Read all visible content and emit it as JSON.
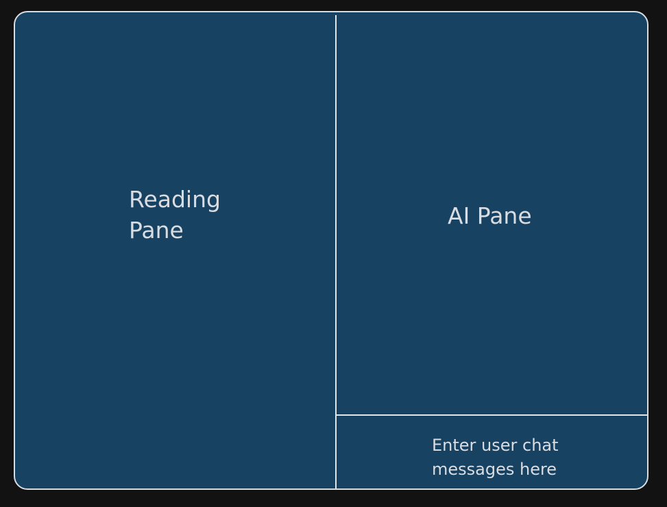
{
  "reading_pane": {
    "label": "Reading Pane"
  },
  "ai_pane": {
    "label": "AI Pane"
  },
  "chat_input": {
    "placeholder": "Enter user chat messages here"
  },
  "colors": {
    "background": "#121212",
    "pane_fill": "#184262",
    "outline": "#d8dde2",
    "text": "#d9dde2"
  }
}
